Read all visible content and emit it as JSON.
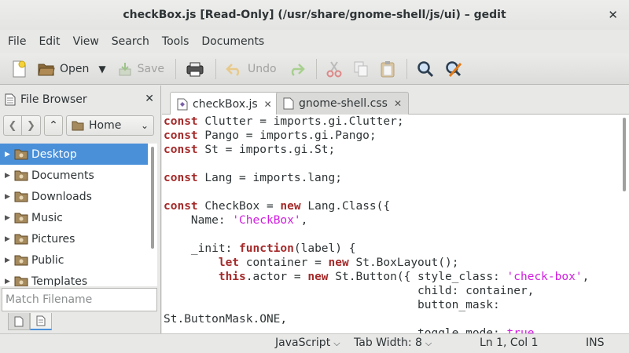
{
  "window": {
    "title": "checkBox.js [Read-Only] (/usr/share/gnome-shell/js/ui) – gedit",
    "close_glyph": "✕"
  },
  "menubar": {
    "items": [
      "File",
      "Edit",
      "View",
      "Search",
      "Tools",
      "Documents"
    ]
  },
  "toolbar": {
    "new_icon": "document-new-icon",
    "open_label": "Open",
    "save_label": "Save",
    "print_icon": "printer-icon",
    "undo_label": "Undo",
    "redo_icon": "redo-arrow-icon",
    "cut_icon": "scissors-icon",
    "copy_icon": "copy-icon",
    "paste_icon": "clipboard-icon",
    "find_icon": "magnifier-icon",
    "replace_icon": "find-replace-icon"
  },
  "side_panel": {
    "title": "File Browser",
    "location": "Home",
    "filter_placeholder": "Match Filename",
    "items": [
      {
        "label": "Desktop",
        "selected": true
      },
      {
        "label": "Documents",
        "selected": false
      },
      {
        "label": "Downloads",
        "selected": false
      },
      {
        "label": "Music",
        "selected": false
      },
      {
        "label": "Pictures",
        "selected": false
      },
      {
        "label": "Public",
        "selected": false
      },
      {
        "label": "Templates",
        "selected": false
      }
    ]
  },
  "tabs": [
    {
      "label": "checkBox.js",
      "active": true
    },
    {
      "label": "gnome-shell.css",
      "active": false
    }
  ],
  "code_lines": [
    [
      [
        "kw",
        "const"
      ],
      [
        "t",
        " Clutter = imports.gi.Clutter;"
      ]
    ],
    [
      [
        "kw",
        "const"
      ],
      [
        "t",
        " Pango = imports.gi.Pango;"
      ]
    ],
    [
      [
        "kw",
        "const"
      ],
      [
        "t",
        " St = imports.gi.St;"
      ]
    ],
    [
      [
        "t",
        ""
      ]
    ],
    [
      [
        "kw",
        "const"
      ],
      [
        "t",
        " Lang = imports.lang;"
      ]
    ],
    [
      [
        "t",
        ""
      ]
    ],
    [
      [
        "kw",
        "const"
      ],
      [
        "t",
        " CheckBox = "
      ],
      [
        "kw",
        "new"
      ],
      [
        "t",
        " Lang.Class({"
      ]
    ],
    [
      [
        "t",
        "    Name: "
      ],
      [
        "str",
        "'CheckBox'"
      ],
      [
        "t",
        ","
      ]
    ],
    [
      [
        "t",
        ""
      ]
    ],
    [
      [
        "t",
        "    _init: "
      ],
      [
        "kw",
        "function"
      ],
      [
        "t",
        "(label) {"
      ]
    ],
    [
      [
        "t",
        "        "
      ],
      [
        "kw",
        "let"
      ],
      [
        "t",
        " container = "
      ],
      [
        "kw",
        "new"
      ],
      [
        "t",
        " St.BoxLayout();"
      ]
    ],
    [
      [
        "t",
        "        "
      ],
      [
        "kw",
        "this"
      ],
      [
        "t",
        ".actor = "
      ],
      [
        "kw",
        "new"
      ],
      [
        "t",
        " St.Button({ style_class: "
      ],
      [
        "str",
        "'check-box'"
      ],
      [
        "t",
        ","
      ]
    ],
    [
      [
        "t",
        "                                     child: container,"
      ]
    ],
    [
      [
        "t",
        "                                     button_mask:"
      ]
    ],
    [
      [
        "t",
        "St.ButtonMask.ONE,"
      ]
    ],
    [
      [
        "t",
        "                                     toggle_mode: "
      ],
      [
        "str",
        "true"
      ],
      [
        "t",
        ","
      ]
    ]
  ],
  "status": {
    "language": "JavaScript",
    "tab_width": "Tab Width: 8",
    "position": "Ln 1, Col 1",
    "mode": "INS"
  }
}
